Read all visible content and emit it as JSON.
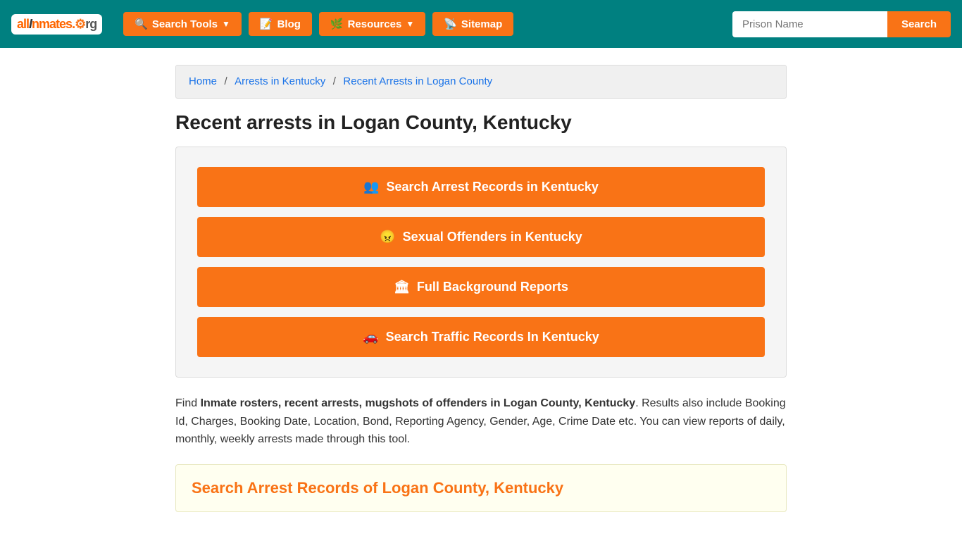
{
  "nav": {
    "logo": "allInmates.org",
    "search_tools_label": "Search Tools",
    "blog_label": "Blog",
    "resources_label": "Resources",
    "sitemap_label": "Sitemap",
    "prison_name_placeholder": "Prison Name",
    "search_btn_label": "Search"
  },
  "breadcrumb": {
    "home": "Home",
    "arrests_in_ky": "Arrests in Kentucky",
    "recent_arrests": "Recent Arrests in Logan County"
  },
  "page": {
    "title": "Recent arrests in Logan County, Kentucky",
    "buttons": [
      {
        "icon": "👥",
        "label": "Search Arrest Records in Kentucky"
      },
      {
        "icon": "😠",
        "label": "Sexual Offenders in Kentucky"
      },
      {
        "icon": "🏛",
        "label": "Full Background Reports"
      },
      {
        "icon": "🚗",
        "label": "Search Traffic Records In Kentucky"
      }
    ],
    "description_plain": ". Results also include Booking Id, Charges, Booking Date, Location, Bond, Reporting Agency, Gender, Age, Crime Date etc. You can view reports of daily, monthly, weekly arrests made through this tool.",
    "description_bold": "Inmate rosters, recent arrests, mugshots of offenders in Logan County, Kentucky",
    "description_prefix": "Find ",
    "search_section_title": "Search Arrest Records of Logan County, Kentucky"
  }
}
